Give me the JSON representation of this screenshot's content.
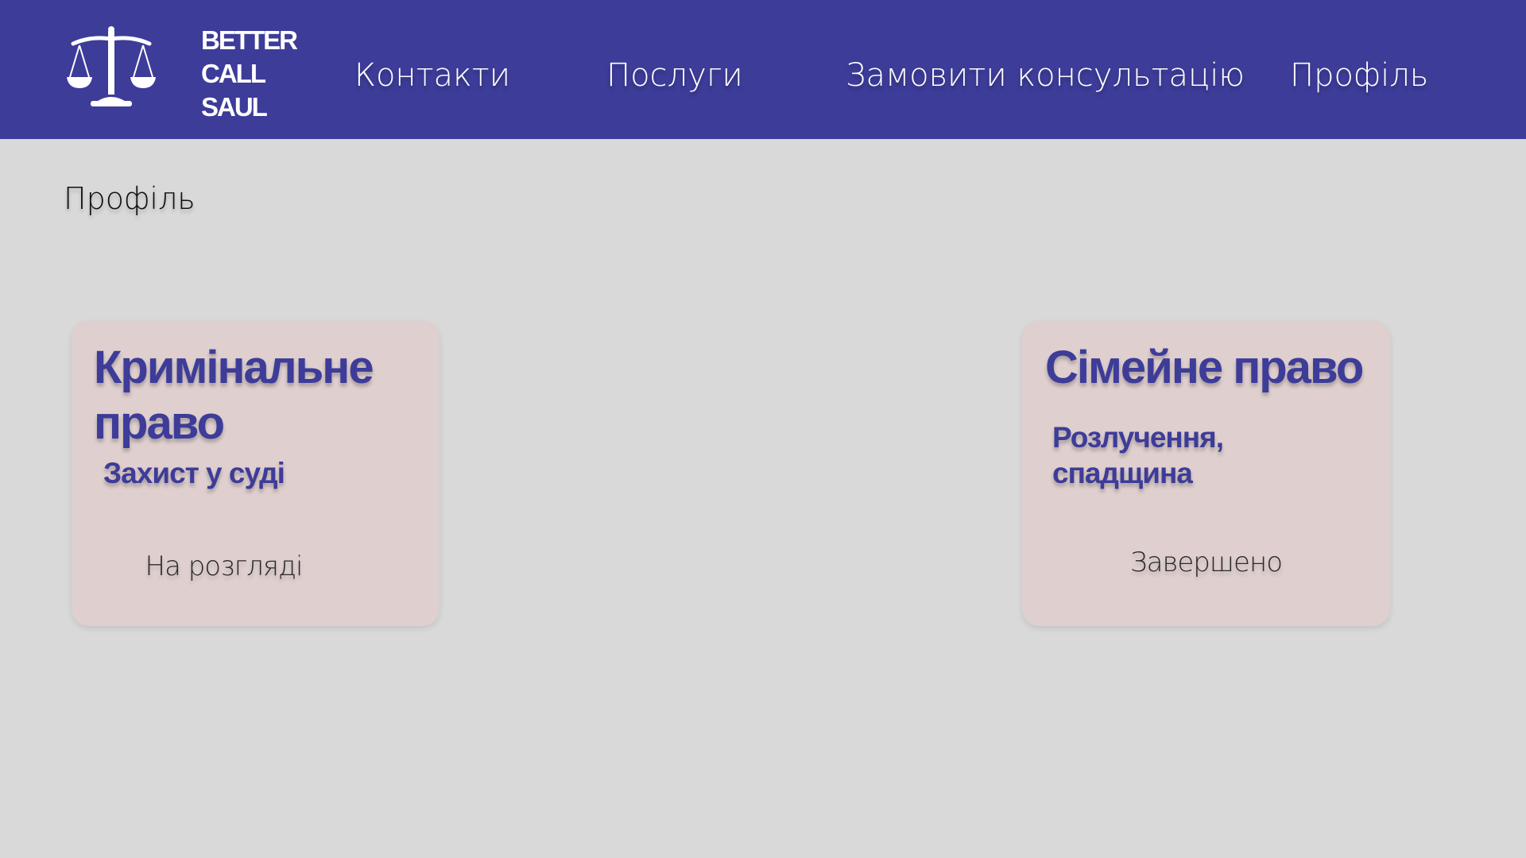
{
  "header": {
    "logo": {
      "icon": "scales-of-justice-icon",
      "lines": [
        "BETTER",
        "CALL",
        "SAUL"
      ]
    },
    "nav": {
      "contacts": "Контакти",
      "services": "Послуги",
      "order_consultation": "Замовити консультацію",
      "profile": "Профіль"
    }
  },
  "main": {
    "title": "Профіль",
    "cards": [
      {
        "title": "Кримінальне право",
        "subtitle": "Захист у суді",
        "status": "На розгляді"
      },
      {
        "title": "Сімейне право",
        "subtitle": "Розлучення, спадщина",
        "status": "Завершено"
      }
    ]
  },
  "colors": {
    "header_background": "#3d3c99",
    "page_background": "#d9d9d9",
    "card_background": "#dfcfcf",
    "accent_text": "#3d3c99",
    "header_text": "#ffffff"
  }
}
